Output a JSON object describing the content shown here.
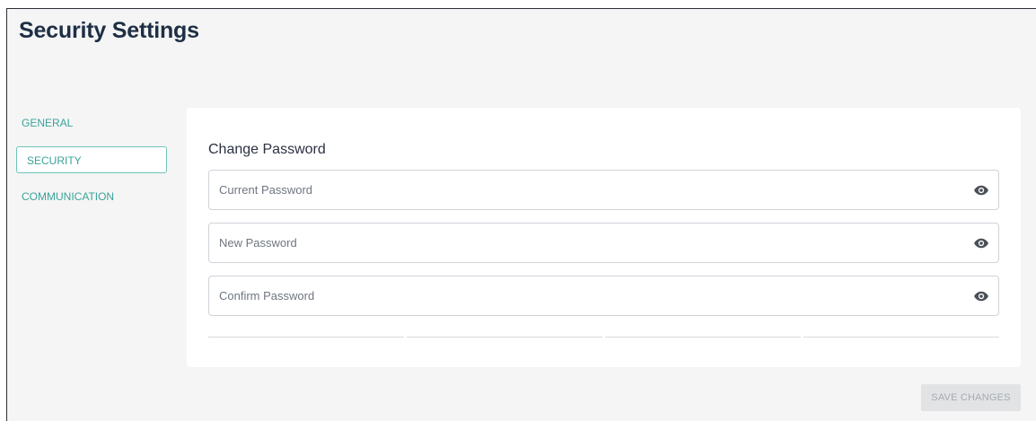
{
  "page": {
    "title": "Security Settings"
  },
  "sidebar": {
    "items": [
      {
        "label": "GENERAL",
        "active": false
      },
      {
        "label": "SECURITY",
        "active": true
      },
      {
        "label": "COMMUNICATION",
        "active": false
      }
    ]
  },
  "change_password": {
    "title": "Change Password",
    "fields": [
      {
        "placeholder": "Current Password",
        "value": "",
        "icon": "eye-icon"
      },
      {
        "placeholder": "New Password",
        "value": "",
        "icon": "eye-icon"
      },
      {
        "placeholder": "Confirm Password",
        "value": "",
        "icon": "eye-icon"
      }
    ],
    "strength_meter": {
      "segments": 4,
      "filled": 0
    }
  },
  "actions": {
    "save_label": "SAVE CHANGES",
    "save_enabled": false
  },
  "colors": {
    "accent": "#3aa39a",
    "title": "#1e2f45",
    "background": "#f5f5f5",
    "disabled_button": "#e1e3e5"
  }
}
